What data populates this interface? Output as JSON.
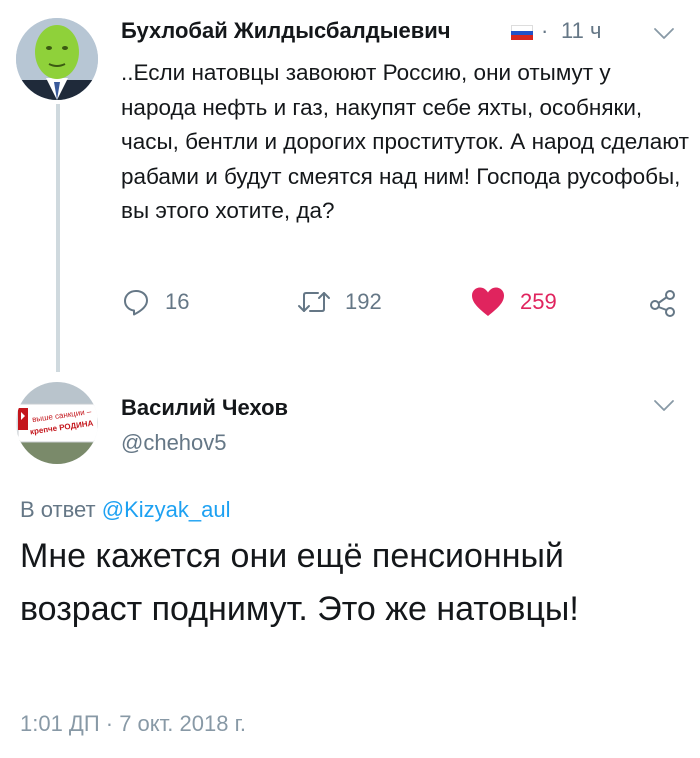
{
  "tweet1": {
    "author_name": "Бухлобай Жилдысбалдыевич",
    "flag_colors": [
      "#ffffff",
      "#2152c8",
      "#d7261e"
    ],
    "dot": "·",
    "time": "11 ч",
    "text": "..Если натовцы  завоюют Россию, они отымут у народа нефть и газ, накупят себе яхты, особняки, часы, бентли и дорогих проституток. А народ сделают рабами и будут смеятся над ним! Господа русофобы, вы этого хотите, да?",
    "replies": "16",
    "retweets": "192",
    "likes": "259",
    "liked_color": "#e0245e"
  },
  "tweet2": {
    "author_name": "Василий Чехов",
    "handle": "@chehov5",
    "reply_prefix": "В ответ ",
    "reply_handle": "@Kizyak_aul",
    "text": "Мне кажется они ещё пенсионный возраст поднимут. Это же натовцы!",
    "timestamp": "1:01 ДП · 7 окт. 2018 г.",
    "avatar_text_1": "выше санкции –",
    "avatar_text_2": "крепче РОДИНА"
  },
  "colors": {
    "text": "#14171a",
    "secondary": "#657786",
    "link": "#1da1f2",
    "thread_line": "#cfd9de"
  }
}
